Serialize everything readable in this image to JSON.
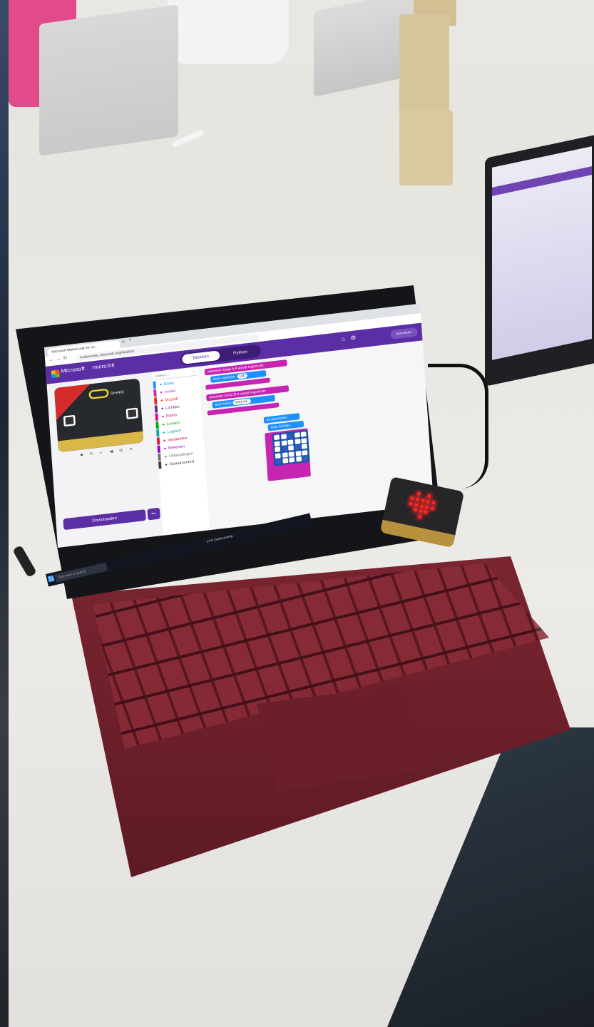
{
  "browser": {
    "tab_title": "Microsoft MakeCode for mi...",
    "url": "makecode.microbit.org/#editor"
  },
  "header": {
    "microsoft": "Microsoft",
    "microbit": "micro:bit",
    "blocks_tab": "Blokken",
    "python_tab": "Python",
    "account_button": "Aanmelden"
  },
  "simulator": {
    "shake_label": "SHAKE",
    "download_button": "Downloaden",
    "more_button": "•••"
  },
  "toolbox": {
    "search_placeholder": "Zoeken...",
    "categories": [
      {
        "label": "Basis",
        "color": "#1e90ff"
      },
      {
        "label": "Invoer",
        "color": "#c724b1"
      },
      {
        "label": "Muziek",
        "color": "#e63022"
      },
      {
        "label": "Lichtjes",
        "color": "#5c2d91"
      },
      {
        "label": "Radio",
        "color": "#e3008c"
      },
      {
        "label": "Lussen",
        "color": "#00aa00"
      },
      {
        "label": "Logisch",
        "color": "#00a4a6"
      },
      {
        "label": "Variabelen",
        "color": "#dc143c"
      },
      {
        "label": "Rekenen",
        "color": "#9400d3"
      },
      {
        "label": "Uitbreidingen",
        "color": "#707070"
      },
      {
        "label": "Geavanceerd",
        "color": "#3c3c3c"
      }
    ]
  },
  "blocks": {
    "event_a": "wanneer knop A ▾ wordt ingedrukt",
    "show_number": "toon nummer",
    "show_number_value": "100",
    "event_b": "wanneer knop B ▾ wordt ingedrukt",
    "show_string": "toon tekst",
    "show_string_value": "Jeej ml..",
    "on_start": "bij opstarten",
    "show_leds": "toon lichtjes"
  },
  "taskbar": {
    "search": "Type here to search",
    "weather": "17°C  Deels zonnig"
  },
  "colors": {
    "accent": "#5c2ea6",
    "laptop_cover": "#6e1f2b",
    "led_red": "#ff2a2a"
  }
}
